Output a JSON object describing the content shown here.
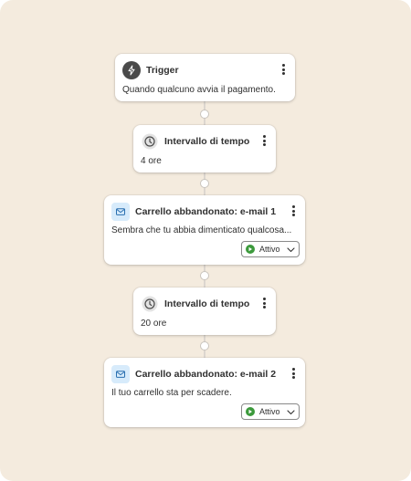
{
  "workflow": {
    "steps": [
      {
        "type": "trigger",
        "title": "Trigger",
        "body": "Quando qualcuno avvia il pagamento.",
        "icon": "lightning-icon"
      },
      {
        "type": "delay",
        "title": "Intervallo di tempo",
        "body": "4 ore",
        "icon": "clock-icon"
      },
      {
        "type": "email",
        "title": "Carrello abbandonato: e-mail 1",
        "body": "Sembra che tu abbia dimenticato qualcosa...",
        "icon": "envelope-icon",
        "status": "Attivo"
      },
      {
        "type": "delay",
        "title": "Intervallo di tempo",
        "body": "20 ore",
        "icon": "clock-icon"
      },
      {
        "type": "email",
        "title": "Carrello abbandonato: e-mail 2",
        "body": "Il tuo carrello sta per scadere.",
        "icon": "envelope-icon",
        "status": "Attivo"
      }
    ]
  },
  "colors": {
    "background": "#f4ebde",
    "status_active": "#3c9a3c",
    "email_icon_bg": "#d7ebfb"
  }
}
